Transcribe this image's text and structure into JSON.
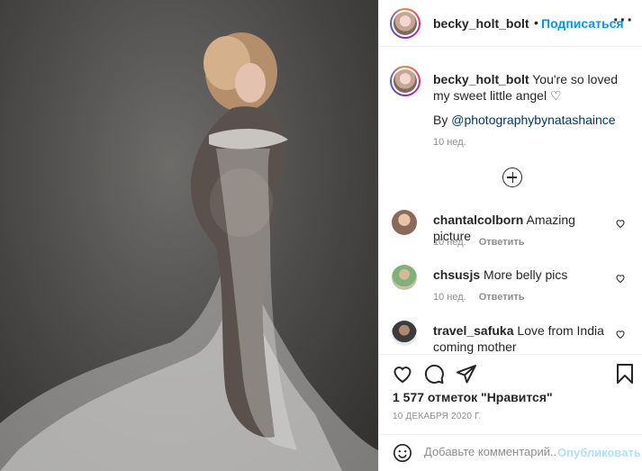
{
  "post": {
    "username": "becky_holt_bolt",
    "follow_label": "Подписаться",
    "separator": "•",
    "more_label": "···",
    "photo_alt": "Maternity portrait with sheer white fabric"
  },
  "caption": {
    "username": "becky_holt_bolt",
    "text": "You're so loved my sweet little angel ♡",
    "by_prefix": "By",
    "by_link": "@photographybynatashaince",
    "time": "10 нед."
  },
  "comments": [
    {
      "username": "chantalcolborn",
      "text": "Amazing picture",
      "time": "10 нед.",
      "reply_label": "Ответить",
      "avatar_color": "#8a6a58"
    },
    {
      "username": "chsusjs",
      "text": "More belly pics",
      "time": "10 нед.",
      "reply_label": "Ответить",
      "avatar_color": "#7fb27a"
    },
    {
      "username": "travel_safuka",
      "text": "Love from India coming mother",
      "time": "",
      "reply_label": "",
      "avatar_color": "#3c3c3c"
    }
  ],
  "stats": {
    "likes": "1 577 отметок \"Нравится\"",
    "date": "10 ДЕКАБРЯ 2020 Г."
  },
  "add_comment": {
    "placeholder": "Добавьте комментарий...",
    "post_label": "Опубликовать"
  },
  "icons": {
    "like": "heart-icon",
    "comment": "comment-icon",
    "share": "share-icon",
    "save": "bookmark-icon",
    "emoji": "emoji-icon",
    "load_more": "plus-circle-icon",
    "more": "more-options-icon"
  },
  "colors": {
    "link": "#00376b",
    "follow": "#0095f6",
    "post_disabled": "#b2dffc",
    "muted": "#8e8e8e",
    "text": "#262626"
  }
}
